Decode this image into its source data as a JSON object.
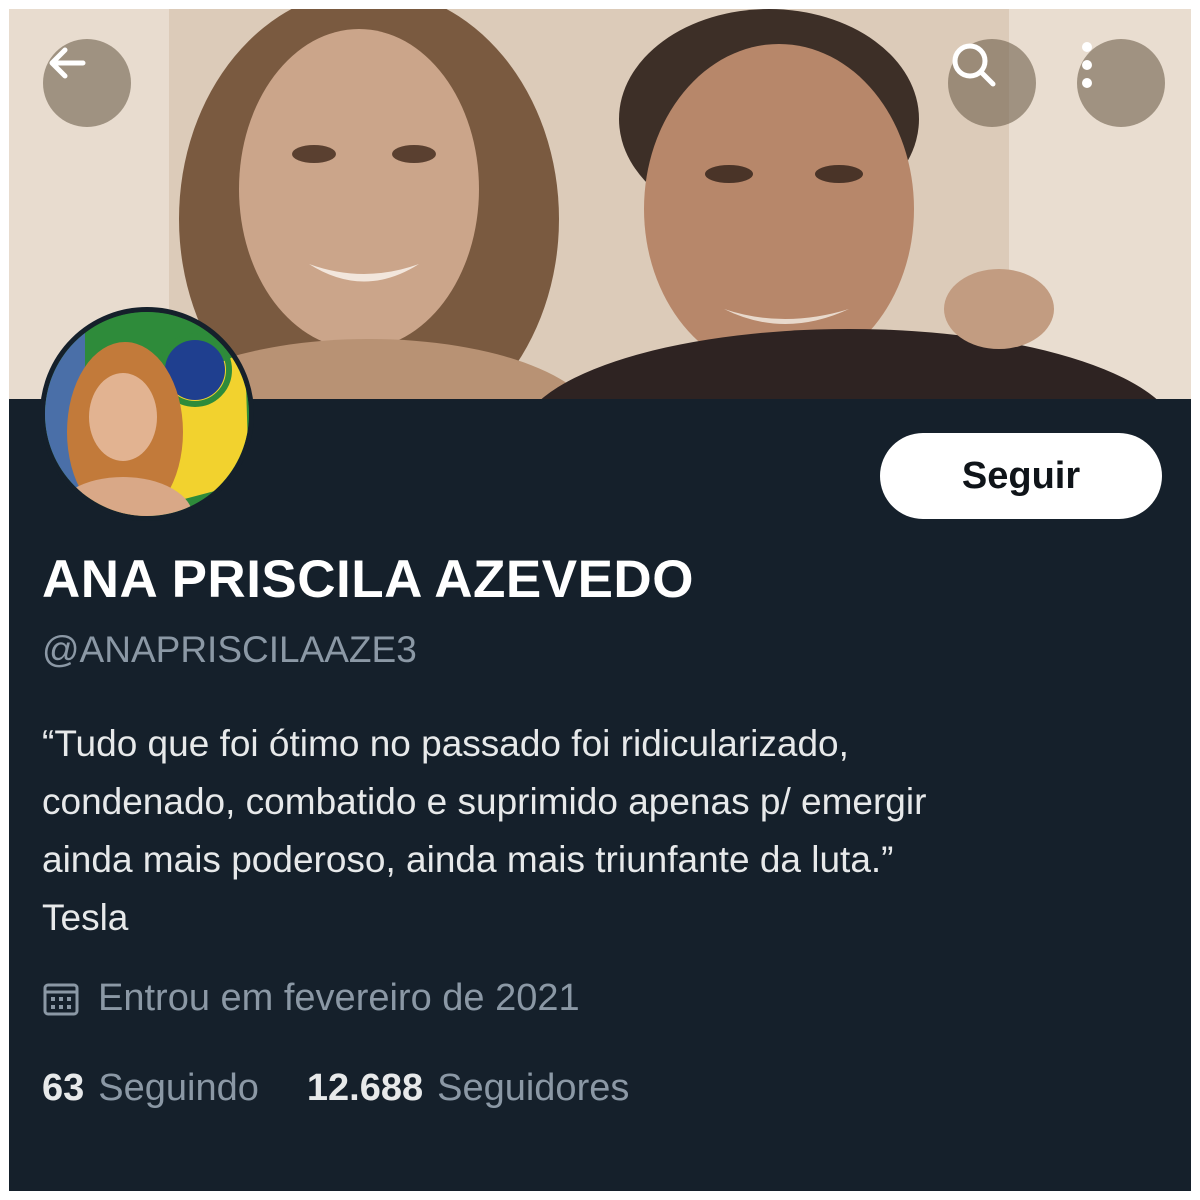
{
  "header": {
    "back_icon": "arrow-left-icon",
    "search_icon": "search-icon",
    "more_icon": "more-vertical-icon"
  },
  "profile": {
    "follow_label": "Seguir",
    "name": "ANA PRISCILA AZEVEDO",
    "handle": "@ANAPRISCILAAZE3",
    "bio_lines": [
      "“Tudo que foi ótimo no passado foi ridicularizado,",
      "condenado, combatido e suprimido apenas p/ emergir",
      "ainda mais poderoso, ainda mais triunfante da luta.”",
      "Tesla"
    ],
    "joined_icon": "calendar-icon",
    "joined": "Entrou em fevereiro de 2021",
    "following_count": "63",
    "following_label": "Seguindo",
    "followers_count": "12.688",
    "followers_label": "Seguidores"
  },
  "colors": {
    "background": "#15202b",
    "primary_text": "#e7e9ea",
    "secondary_text": "#8b98a5",
    "follow_button_bg": "#ffffff"
  }
}
